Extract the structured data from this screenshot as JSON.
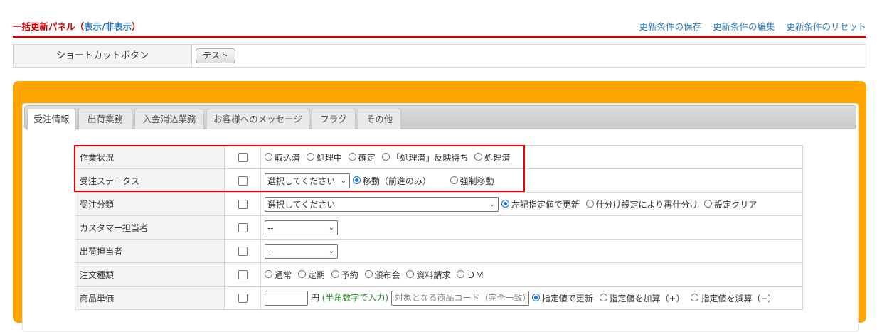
{
  "header": {
    "title": "一括更新パネル",
    "toggle_open": "（",
    "toggle": "表示/非表示",
    "toggle_close": "）",
    "links": [
      "更新条件の保存",
      "更新条件の編集",
      "更新条件のリセット"
    ]
  },
  "shortcut": {
    "label": "ショートカットボタン",
    "button": "テスト"
  },
  "tabs": [
    "受注情報",
    "出荷業務",
    "入金消込業務",
    "お客様へのメッセージ",
    "フラグ",
    "その他"
  ],
  "rows": {
    "work_status": {
      "label": "作業状況",
      "options": [
        "取込済",
        "処理中",
        "確定",
        "「処理済」反映待ち",
        "処理済"
      ]
    },
    "order_status": {
      "label": "受注ステータス",
      "select": "選択してください",
      "options": [
        "移動（前進のみ）",
        "強制移動"
      ],
      "selected": 0
    },
    "order_category": {
      "label": "受注分類",
      "select": "選択してください",
      "options": [
        "左記指定値で更新",
        "仕分け設定により再仕分け",
        "設定クリア"
      ],
      "selected": 0
    },
    "customer_rep": {
      "label": "カスタマー担当者",
      "select": "--"
    },
    "shipping_rep": {
      "label": "出荷担当者",
      "select": "--"
    },
    "order_type": {
      "label": "注文種類",
      "options": [
        "通常",
        "定期",
        "予約",
        "頒布会",
        "資料請求",
        "ＤＭ"
      ]
    },
    "unit_price": {
      "label": "商品単価",
      "unit": "円",
      "hint": "(半角数字で入力)",
      "placeholder": "対象となる商品コード（完全一致）",
      "options": [
        "指定値で更新",
        "指定値を加算（+）",
        "指定値を減算（−）"
      ],
      "selected": 0
    }
  }
}
